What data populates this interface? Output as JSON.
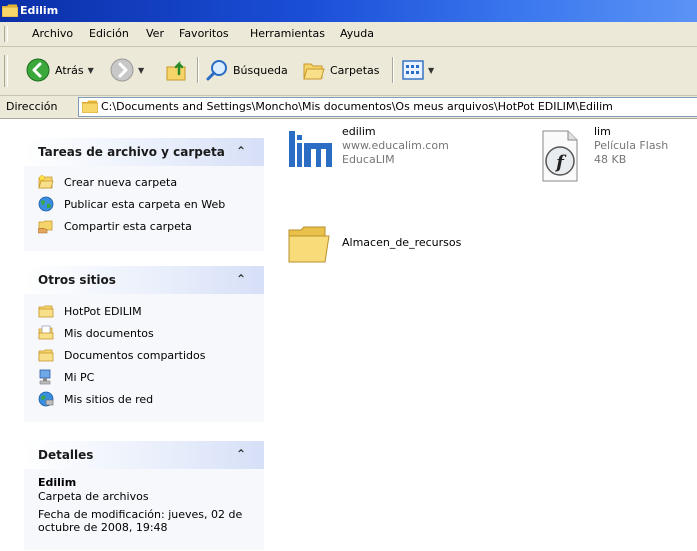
{
  "window": {
    "title": "Edilim"
  },
  "menu": [
    "Archivo",
    "Edición",
    "Ver",
    "Favoritos",
    "Herramientas",
    "Ayuda"
  ],
  "toolbar": {
    "back_label": "Atrás",
    "search_label": "Búsqueda",
    "folders_label": "Carpetas"
  },
  "address": {
    "label": "Dirección",
    "path": "C:\\Documents and Settings\\Moncho\\Mis documentos\\Os meus arquivos\\HotPot EDILIM\\Edilim"
  },
  "tasks_pane": {
    "title": "Tareas de archivo y carpeta",
    "items": [
      {
        "label": "Crear nueva carpeta",
        "icon": "new-folder-icon"
      },
      {
        "label": "Publicar esta carpeta en Web",
        "icon": "web-globe-icon"
      },
      {
        "label": "Compartir esta carpeta",
        "icon": "share-folder-icon"
      }
    ]
  },
  "places_pane": {
    "title": "Otros sitios",
    "items": [
      {
        "label": "HotPot EDILIM",
        "icon": "folder-icon"
      },
      {
        "label": "Mis documentos",
        "icon": "my-documents-icon"
      },
      {
        "label": "Documentos compartidos",
        "icon": "folder-icon"
      },
      {
        "label": "Mi PC",
        "icon": "my-computer-icon"
      },
      {
        "label": "Mis sitios de red",
        "icon": "network-places-icon"
      }
    ]
  },
  "details_pane": {
    "title": "Detalles",
    "name": "Edilim",
    "type": "Carpeta de archivos",
    "modified": "Fecha de modificación: jueves, 02 de octubre de 2008, 19:48"
  },
  "files": [
    {
      "name": "edilim",
      "line2": "www.educalim.com",
      "line3": "EducaLIM",
      "icon": "lim-logo-icon"
    },
    {
      "name": "lim",
      "line2": "Película Flash",
      "line3": "48 KB",
      "icon": "flash-file-icon"
    },
    {
      "name": "Almacen_de_recursos",
      "icon": "folder-icon"
    }
  ],
  "colors": {
    "titlebar": "#0a2fa8",
    "chrome": "#ece9d8",
    "pane_bg": "#f7f8fc",
    "folder": "#f5d56a"
  }
}
